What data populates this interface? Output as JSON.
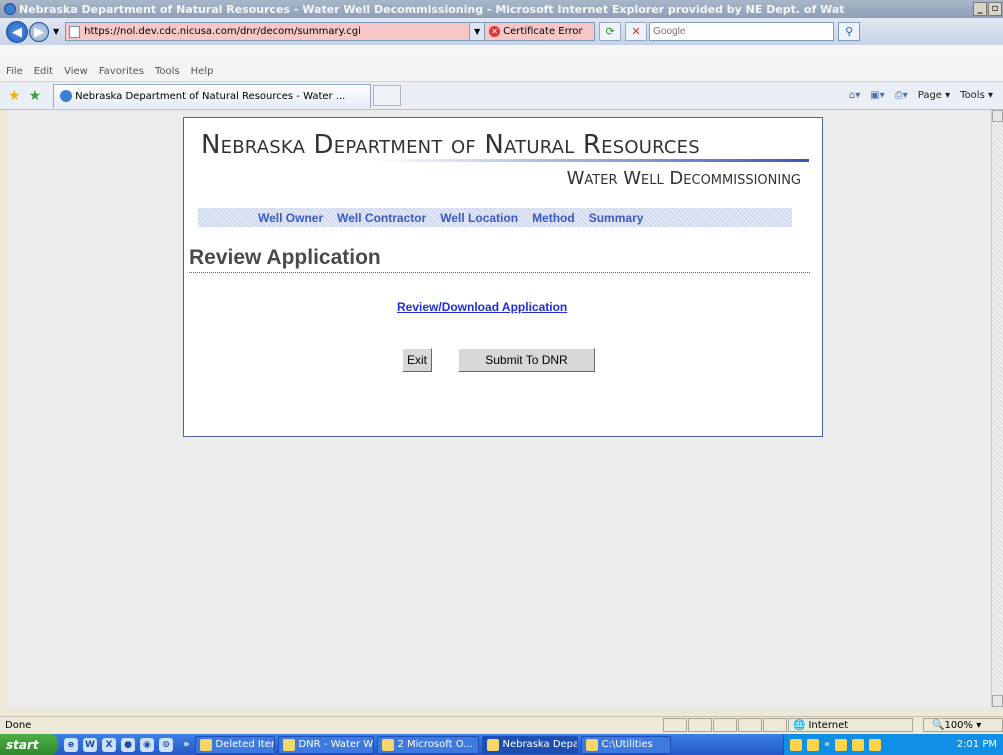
{
  "window": {
    "title": "Nebraska Department of Natural Resources - Water Well Decommissioning - Microsoft Internet Explorer provided by NE Dept. of Wat"
  },
  "address": {
    "url": "https://nol.dev.cdc.nicusa.com/dnr/decom/summary.cgi",
    "cert_error": "Certificate Error",
    "search_placeholder": "Google"
  },
  "menu": [
    "File",
    "Edit",
    "View",
    "Favorites",
    "Tools",
    "Help"
  ],
  "tab": {
    "label": "Nebraska Department of Natural Resources - Water ...",
    "tools": [
      "Page",
      "Tools"
    ]
  },
  "page": {
    "agency": "Nebraska Department of Natural Resources",
    "subtitle": "Water Well Decommissioning",
    "nav": [
      "Well Owner",
      "Well Contractor",
      "Well Location",
      "Method",
      "Summary"
    ],
    "heading": "Review Application",
    "download_link": "Review/Download Application",
    "exit_button": "Exit",
    "submit_button": "Submit To DNR"
  },
  "status": {
    "text": "Done",
    "zone": "Internet",
    "zoom": "100%"
  },
  "taskbar": {
    "start": "start",
    "tasks": [
      "Deleted Items ...",
      "DNR - Water W...",
      "2 Microsoft O...",
      "Nebraska Depa...",
      "C:\\Utilities"
    ],
    "time": "2:01 PM"
  }
}
